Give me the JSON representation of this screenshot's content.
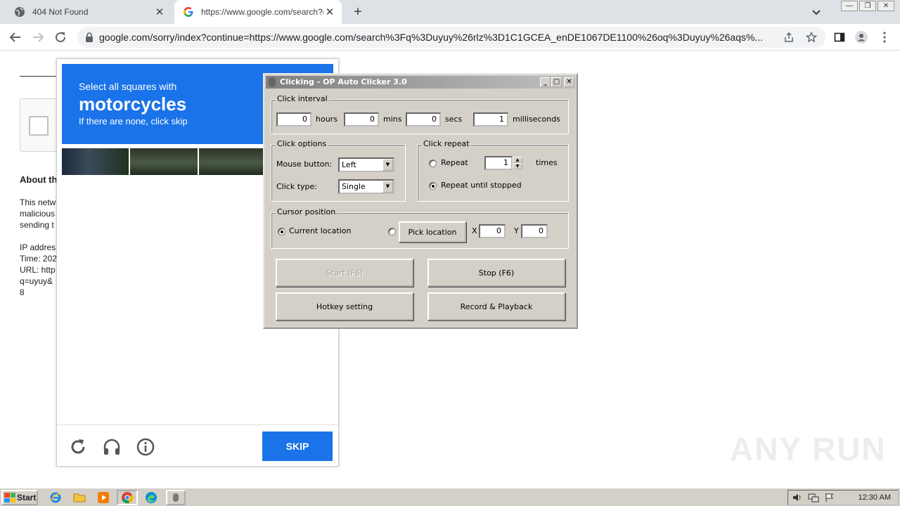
{
  "browser": {
    "tabs": [
      {
        "title": "404 Not Found",
        "active": false
      },
      {
        "title": "https://www.google.com/search?q=",
        "active": true
      }
    ],
    "url": "google.com/sorry/index?continue=https://www.google.com/search%3Fq%3Duyuy%26rlz%3D1C1GCEA_enDE1067DE1100%26oq%3Duyuy%26aqs%...",
    "new_tab": "+",
    "tab_close": "✕"
  },
  "page": {
    "about_heading": "About th",
    "lines": [
      "This netw",
      "malicious",
      "sending t",
      "",
      "IP addres",
      "Time: 202",
      "URL: http",
      "q=uyuy&",
      "8"
    ]
  },
  "captcha": {
    "line1": "Select all squares with",
    "line2": "motorcycles",
    "line3": "If there are none, click skip",
    "skip_label": "SKIP"
  },
  "clicker": {
    "title": "Clicking - OP Auto Clicker 3.0",
    "interval": {
      "legend": "Click interval",
      "hours_value": "0",
      "hours_label": "hours",
      "mins_value": "0",
      "mins_label": "mins",
      "secs_value": "0",
      "secs_label": "secs",
      "ms_value": "1",
      "ms_label": "milliseconds"
    },
    "options": {
      "legend": "Click options",
      "mouse_button_label": "Mouse button:",
      "mouse_button_value": "Left",
      "click_type_label": "Click type:",
      "click_type_value": "Single"
    },
    "repeat": {
      "legend": "Click repeat",
      "repeat_label": "Repeat",
      "repeat_value": "1",
      "times_label": "times",
      "until_stopped_label": "Repeat until stopped"
    },
    "cursor": {
      "legend": "Cursor position",
      "current_label": "Current location",
      "pick_label": "Pick location",
      "x_label": "X",
      "x_value": "0",
      "y_label": "Y",
      "y_value": "0"
    },
    "buttons": {
      "start": "Start (F6)",
      "stop": "Stop (F6)",
      "hotkey": "Hotkey setting",
      "record": "Record & Playback"
    }
  },
  "watermark": "ANY RUN",
  "taskbar": {
    "start_label": "Start",
    "clock": "12:30 AM"
  }
}
